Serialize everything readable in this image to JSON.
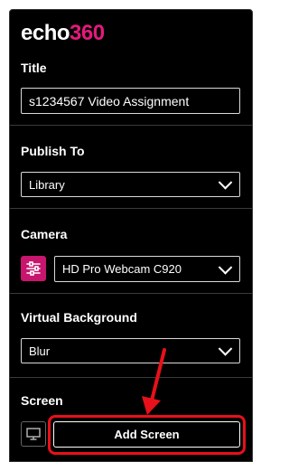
{
  "logo": {
    "part1": "echo",
    "part2": "360"
  },
  "title_section": {
    "label": "Title",
    "value": "s1234567 Video Assignment"
  },
  "publish_section": {
    "label": "Publish To",
    "selected": "Library"
  },
  "camera_section": {
    "label": "Camera",
    "selected": "HD Pro Webcam C920",
    "icon": "sliders-icon"
  },
  "background_section": {
    "label": "Virtual Background",
    "selected": "Blur"
  },
  "screen_section": {
    "label": "Screen",
    "button_label": "Add Screen",
    "icon": "monitor-icon"
  },
  "colors": {
    "accent": "#e5197c",
    "camera_icon_bg": "#c8156e",
    "highlight": "#e8101a",
    "panel_bg": "#000000"
  }
}
